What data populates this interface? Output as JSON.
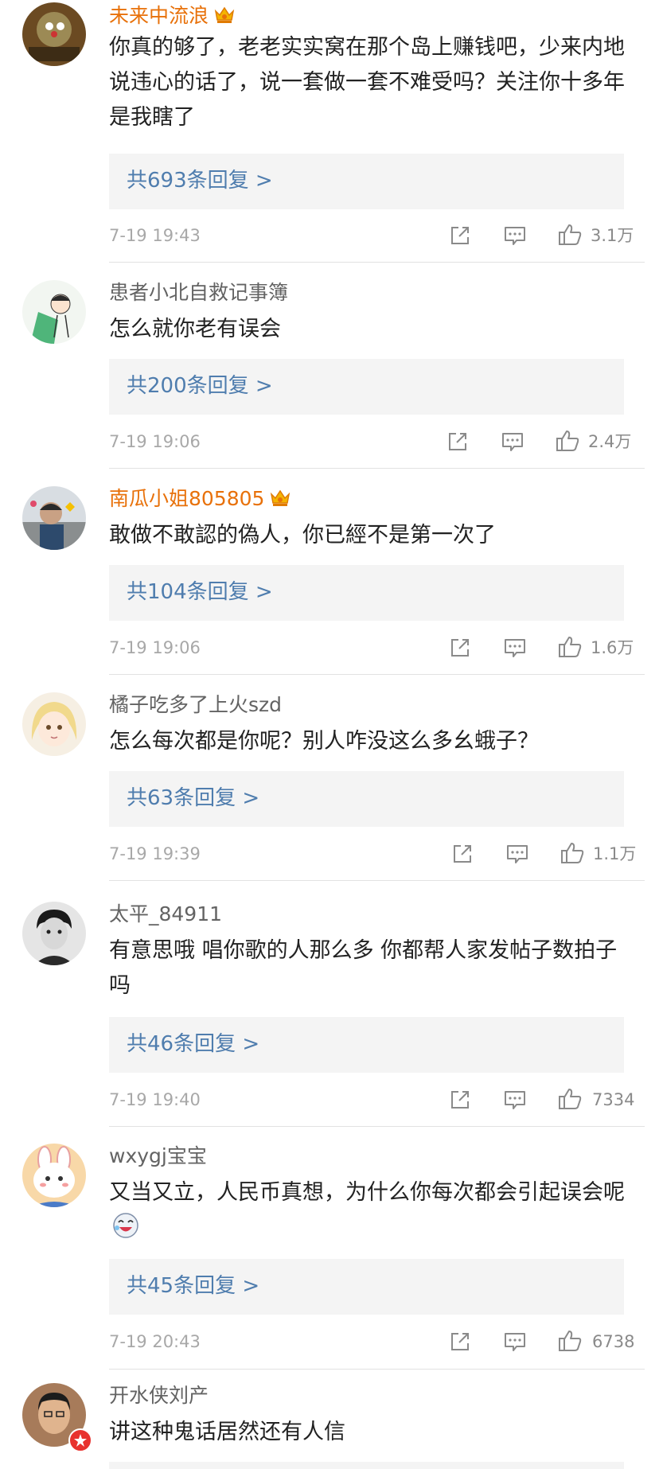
{
  "comments": [
    {
      "username": "未来中流浪",
      "text": "你真的够了，老老实实窝在那个岛上赚钱吧，少来内地说违心的话了，说一套做一套不难受吗？关注你十多年是我瞎了",
      "reply_label": "共693条回复 >",
      "time": "7-19 19:43",
      "likes": "3.1万"
    },
    {
      "username": "患者小北自救记事簿",
      "text": "怎么就你老有误会",
      "reply_label": "共200条回复 >",
      "time": "7-19 19:06",
      "likes": "2.4万"
    },
    {
      "username": "南瓜小姐805805",
      "text": "敢做不敢認的偽人，你已經不是第一次了",
      "reply_label": "共104条回复 >",
      "time": "7-19 19:06",
      "likes": "1.6万"
    },
    {
      "username": "橘子吃多了上火szd",
      "text": "怎么每次都是你呢？别人咋没这么多幺蛾子？",
      "reply_label": "共63条回复 >",
      "time": "7-19 19:39",
      "likes": "1.1万"
    },
    {
      "username": "太平_84911",
      "text": "有意思哦 唱你歌的人那么多 你都帮人家发帖子数拍子吗",
      "reply_label": "共46条回复 >",
      "time": "7-19 19:40",
      "likes": "7334"
    },
    {
      "username": "wxygj宝宝",
      "text": "又当又立，人民币真想，为什么你每次都会引起误会呢",
      "reply_label": "共45条回复 >",
      "time": "7-19 20:43",
      "likes": "6738"
    },
    {
      "username": "开水侠刘产",
      "text": "讲这种鬼话居然还有人信"
    }
  ],
  "colors": {
    "vip_name": "#e8710a",
    "normal_name": "#636363",
    "reply_link": "#4f7dae",
    "reply_bg": "#f4f4f4",
    "meta": "#a8a8a8"
  },
  "icons": {
    "share": "share-icon",
    "comment": "comment-icon",
    "like": "thumbs-up-icon",
    "vip": "crown-badge-icon",
    "emoji": "laughing-emoji-icon"
  }
}
